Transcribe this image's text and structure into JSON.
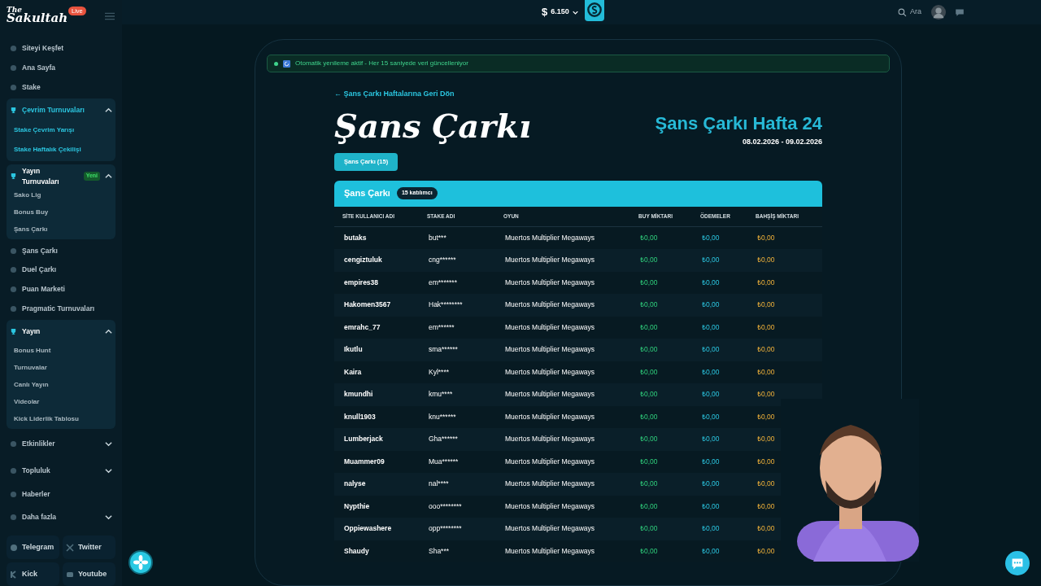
{
  "logo": {
    "line1": "The",
    "line2": "Sakultah",
    "live": "Live"
  },
  "sidebar": {
    "items": [
      {
        "kind": "link",
        "label": "Siteyi Keşfet"
      },
      {
        "kind": "link",
        "label": "Ana Sayfa"
      },
      {
        "kind": "link",
        "label": "Stake"
      },
      {
        "kind": "group",
        "label": "Çevrim Turnuvaları",
        "expanded": true,
        "selected": true,
        "children": [
          {
            "label": "Stake Çevrim Yarışı",
            "selected": true
          },
          {
            "label": "Stake Haftalık Çekilişi",
            "selected": true
          }
        ]
      },
      {
        "kind": "group",
        "label": "Yayın Turnuvaları",
        "badge": "Yeni",
        "expanded": true,
        "selected": false,
        "children": [
          {
            "label": "Sako Lig",
            "selected": false
          },
          {
            "label": "Bonus Buy",
            "selected": false
          },
          {
            "label": "Şans Çarkı",
            "selected": false
          }
        ]
      },
      {
        "kind": "link",
        "label": "Şans Çarkı"
      },
      {
        "kind": "link",
        "label": "Duel Çarkı"
      },
      {
        "kind": "link",
        "label": "Puan Marketi"
      },
      {
        "kind": "link",
        "label": "Pragmatic Turnuvaları"
      },
      {
        "kind": "group",
        "label": "Yayın",
        "expanded": true,
        "selected": false,
        "children": [
          {
            "label": "Bonus Hunt",
            "selected": false
          },
          {
            "label": "Turnuvalar",
            "selected": false
          },
          {
            "label": "Canlı Yayın",
            "selected": false
          },
          {
            "label": "Videolar",
            "selected": false
          },
          {
            "label": "Kick Liderlik Tablosu",
            "selected": false
          }
        ]
      },
      {
        "kind": "group",
        "label": "Etkinlikler",
        "expanded": false,
        "selected": false
      },
      {
        "kind": "group",
        "label": "Topluluk",
        "expanded": false,
        "selected": false
      },
      {
        "kind": "link",
        "label": "Haberler"
      },
      {
        "kind": "group",
        "label": "Daha fazla",
        "expanded": false,
        "selected": false
      }
    ],
    "socials": [
      "Telegram",
      "Twitter",
      "Kick",
      "Youtube"
    ]
  },
  "topbar": {
    "currency": "$",
    "balance": "6.150",
    "search": "Ara"
  },
  "notice": "Otomatik yenileme aktif - Her 15 saniyede veri güncelleniyor",
  "back_link": "← Şans Çarkı Haftalarına Geri Dön",
  "title": "Şans Çarkı",
  "week_title": "Şans Çarkı Hafta 24",
  "dates": "08.02.2026 - 09.02.2026",
  "tabs": [
    {
      "label": "Şans Çarkı",
      "count": "(15)",
      "selected": true
    }
  ],
  "table": {
    "title": "Şans Çarkı",
    "badge": "15 katılımcı",
    "columns": [
      "SİTE KULLANICI ADI",
      "STAKE ADI",
      "OYUN",
      "BUY MİKTARI",
      "ÖDEMELER",
      "BAHŞİŞ MİKTARI"
    ],
    "rows": [
      [
        "butaks",
        "but***",
        "Muertos Multiplier Megaways",
        "₺0,00",
        "₺0,00",
        "₺0,00"
      ],
      [
        "cengiztuluk",
        "cng******",
        "Muertos Multiplier Megaways",
        "₺0,00",
        "₺0,00",
        "₺0,00"
      ],
      [
        "empires38",
        "em*******",
        "Muertos Multiplier Megaways",
        "₺0,00",
        "₺0,00",
        "₺0,00"
      ],
      [
        "Hakomen3567",
        "Hak********",
        "Muertos Multiplier Megaways",
        "₺0,00",
        "₺0,00",
        "₺0,00"
      ],
      [
        "emrahc_77",
        "em******",
        "Muertos Multiplier Megaways",
        "₺0,00",
        "₺0,00",
        "₺0,00"
      ],
      [
        "Ikutlu",
        "sma******",
        "Muertos Multiplier Megaways",
        "₺0,00",
        "₺0,00",
        "₺0,00"
      ],
      [
        "Kaira",
        "Kyl****",
        "Muertos Multiplier Megaways",
        "₺0,00",
        "₺0,00",
        "₺0,00"
      ],
      [
        "kmundhi",
        "kmu****",
        "Muertos Multiplier Megaways",
        "₺0,00",
        "₺0,00",
        "₺0,00"
      ],
      [
        "knull1903",
        "knu******",
        "Muertos Multiplier Megaways",
        "₺0,00",
        "₺0,00",
        "₺0,00"
      ],
      [
        "Lumberjack",
        "Gha******",
        "Muertos Multiplier Megaways",
        "₺0,00",
        "₺0,00",
        "₺0,00"
      ],
      [
        "Muammer09",
        "Mua******",
        "Muertos Multiplier Megaways",
        "₺0,00",
        "₺0,00",
        "₺0,00"
      ],
      [
        "nalyse",
        "nal****",
        "Muertos Multiplier Megaways",
        "₺0,00",
        "₺0,00",
        "₺0,00"
      ],
      [
        "Nypthie",
        "ooo********",
        "Muertos Multiplier Megaways",
        "₺0,00",
        "₺0,00",
        "₺0,00"
      ],
      [
        "Oppiewashere",
        "opp********",
        "Muertos Multiplier Megaways",
        "₺0,00",
        "₺0,00",
        "₺0,00"
      ],
      [
        "Shaudy",
        "Sha***",
        "Muertos Multiplier Megaways",
        "₺0,00",
        "₺0,00",
        "₺0,00"
      ]
    ]
  }
}
